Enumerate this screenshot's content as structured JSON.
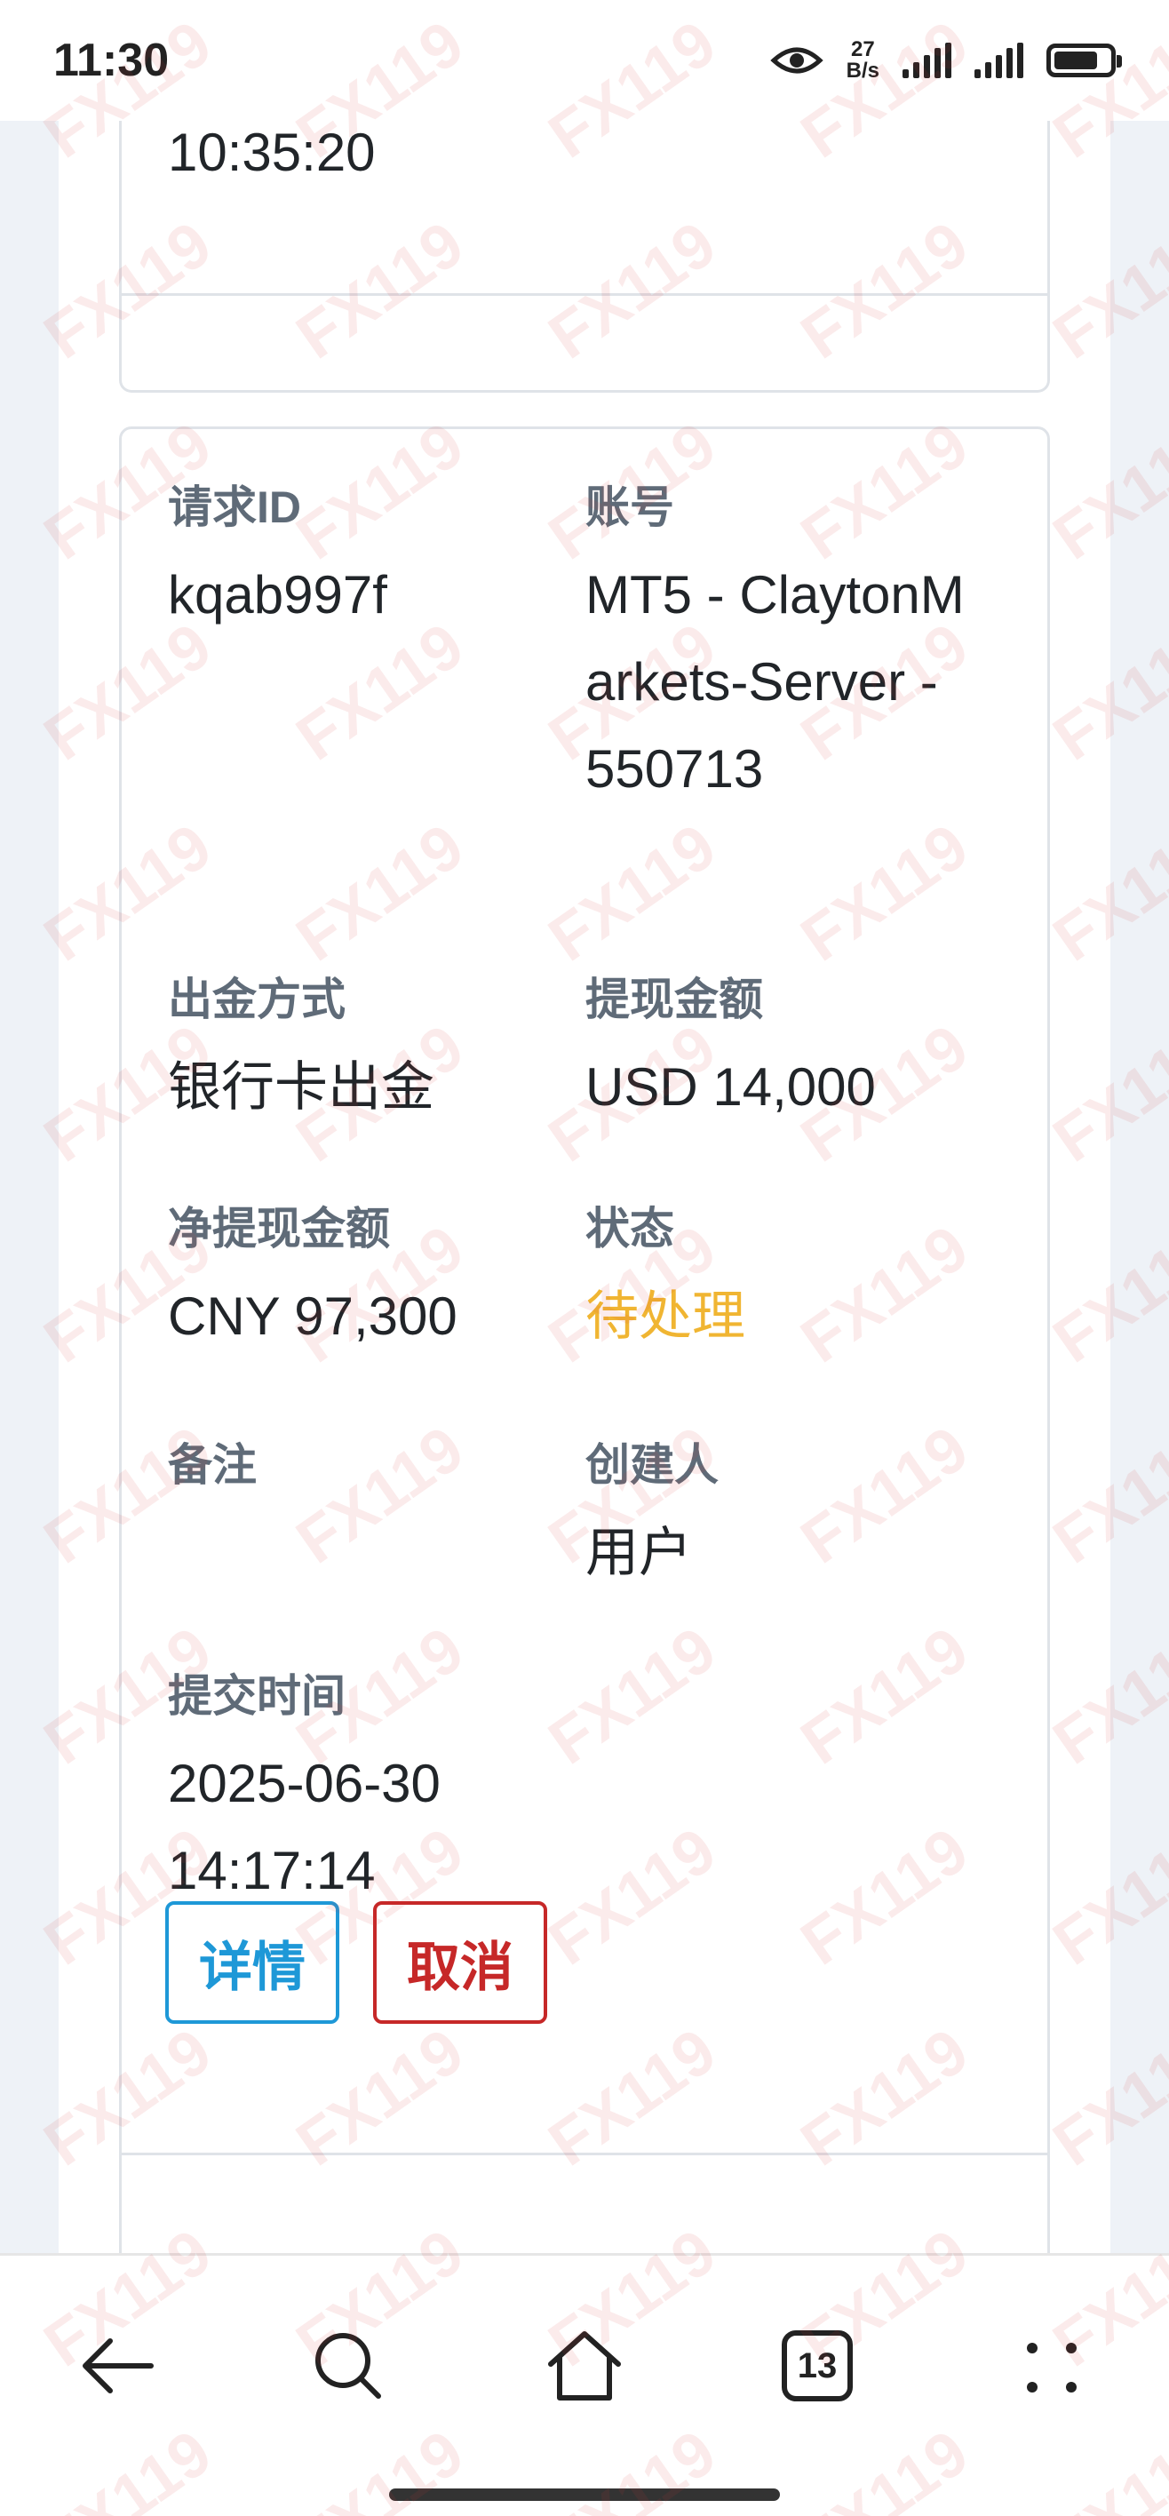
{
  "status_bar": {
    "time": "11:30",
    "net_speed_value": "27",
    "net_speed_unit": "B/s"
  },
  "previous_card": {
    "submit_time_tail": "10:35:20"
  },
  "card": {
    "request_id_label": "请求ID",
    "request_id_value": "kqab997f",
    "account_label": "账号",
    "account_value": "MT5 - ClaytonMarkets-Server - 550713",
    "method_label": "出金方式",
    "method_value": "银行卡出金",
    "amount_label": "提现金额",
    "amount_value": "USD 14,000",
    "net_amount_label": "净提现金额",
    "net_amount_value": "CNY 97,300",
    "status_label": "状态",
    "status_value": "待处理",
    "note_label": "备注",
    "note_value": "",
    "creator_label": "创建人",
    "creator_value": "用户",
    "submit_time_label": "提交时间",
    "submit_date": "2025-06-30",
    "submit_time": "14:17:14",
    "detail_button": "详情",
    "cancel_button": "取消"
  },
  "nav_bar": {
    "tab_count": "13"
  },
  "watermark": "FX119",
  "colors": {
    "pending": "#f0b532",
    "detail": "#1e98d7",
    "cancel": "#c62828"
  }
}
